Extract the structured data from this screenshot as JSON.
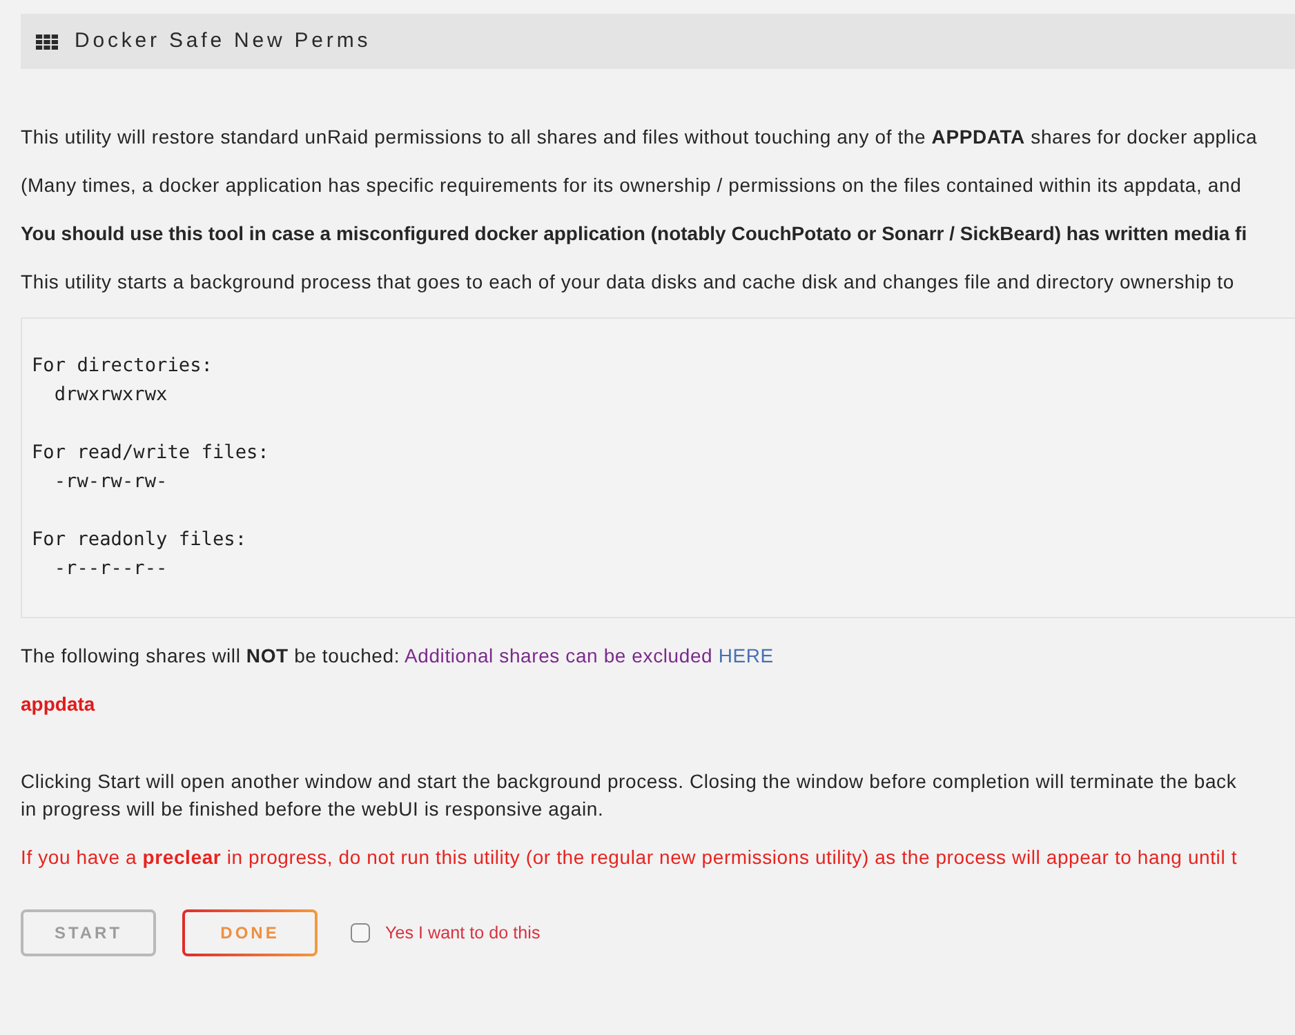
{
  "header": {
    "title": "Docker Safe New Perms"
  },
  "paragraphs": [
    {
      "kind": "plain",
      "text": "This utility will restore standard unRaid permissions to all shares and files without touching any of the **APPDATA** shares for docker applica"
    },
    {
      "kind": "plain",
      "text": "(Many times, a docker application has specific requirements for its ownership / permissions on the files contained within its appdata, and"
    },
    {
      "kind": "bold",
      "text": "You should use this tool in case a misconfigured docker application (notably CouchPotato or Sonarr / SickBeard) has written media fi"
    },
    {
      "kind": "plain",
      "text": "This utility starts a background process that goes to each of your data disks and cache disk and changes file and directory ownership to"
    }
  ],
  "permissions": [
    {
      "heading": "For directories:",
      "value": "drwxrwxrwx"
    },
    {
      "heading": "For read/write files:",
      "value": "-rw-rw-rw-"
    },
    {
      "heading": "For readonly files:",
      "value": "-r--r--r--"
    }
  ],
  "excluded_note": {
    "text": "The following shares will **NOT** be touched:",
    "hint": "Additional shares can be excluded",
    "link": "HERE"
  },
  "excluded_shares": [
    "appdata"
  ],
  "start_note": [
    "Clicking Start will open another window and start the background process. Closing the window before completion will terminate the back",
    "in progress will be finished before the webUI is responsive again."
  ],
  "warning": "If you have a **preclear** in progress, do not run this utility (or the regular new permissions utility) as the process will appear to hang until t",
  "buttons": [
    {
      "kind": "start",
      "label": "START",
      "disabled": true
    },
    {
      "kind": "done",
      "label": "DONE",
      "disabled": false
    }
  ],
  "confirm": {
    "label": "Yes I want to do this",
    "checked": false
  }
}
